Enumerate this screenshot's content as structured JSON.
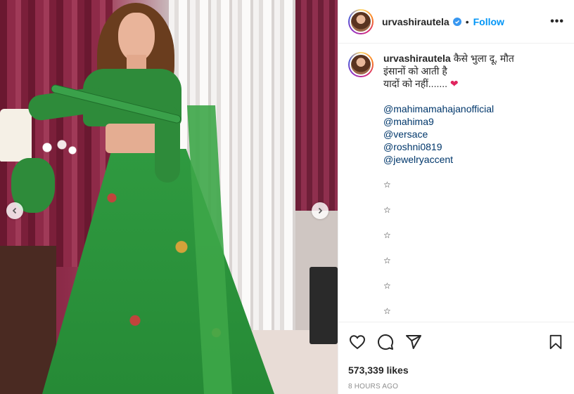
{
  "post": {
    "image_alt": "",
    "carousel": {
      "prev_icon": "chevron-left-icon",
      "next_icon": "chevron-right-icon"
    }
  },
  "header": {
    "username": "urvashirautela",
    "separator": "•",
    "follow_label": "Follow",
    "more_label": "•••"
  },
  "caption": {
    "username": "urvashirautela",
    "text_line1": "कैसे भुला दू, मौत",
    "text_line2": "इंसानों को आती है",
    "text_line3": "यादों को नहीं.......",
    "heart": "❤",
    "mentions": [
      "@mahimamahajanofficial",
      "@mahima9",
      "@versace",
      "@roshni0819",
      "@jewelryaccent"
    ],
    "stars": [
      "☆",
      "☆",
      "☆",
      "☆",
      "☆",
      "☆"
    ]
  },
  "actions": {
    "like_icon": "heart-icon",
    "comment_icon": "comment-icon",
    "share_icon": "share-icon",
    "save_icon": "bookmark-icon"
  },
  "likes": "573,339 likes",
  "timestamp": "8 HOURS AGO",
  "colors": {
    "accent": "#0095f6",
    "mention": "#00376b",
    "heart": "#e0245e",
    "muted": "#8e8e8e"
  }
}
